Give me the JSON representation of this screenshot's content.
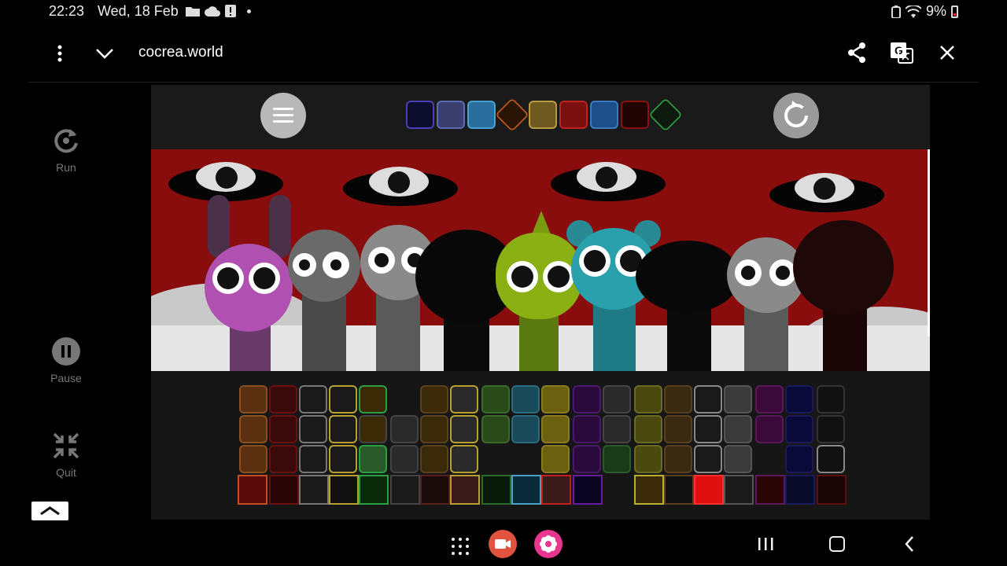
{
  "status_bar": {
    "time": "22:23",
    "date": "Wed, 18 Feb",
    "battery": "9%",
    "icons": [
      "folder-icon",
      "cloud-icon",
      "alert-icon",
      "dot-icon",
      "battery-saver-icon",
      "wifi-icon",
      "battery-icon"
    ]
  },
  "browser": {
    "url": "cocrea.world",
    "icons": [
      "more-vert-icon",
      "chevron-down-icon",
      "share-icon",
      "translate-icon",
      "close-icon"
    ]
  },
  "side_panel": {
    "run_label": "Run",
    "pause_label": "Pause",
    "quit_label": "Quit"
  },
  "game": {
    "menu_button_icon": "hamburger-icon",
    "reset_button_icon": "reset-icon",
    "bonus_count": 9,
    "tray_rows": 4
  },
  "colors": {
    "stage_bg": "#8a0d0d",
    "game_bg": "#1c1c1c",
    "record_button": "#e2533f",
    "flower_button": "#e8368f"
  }
}
